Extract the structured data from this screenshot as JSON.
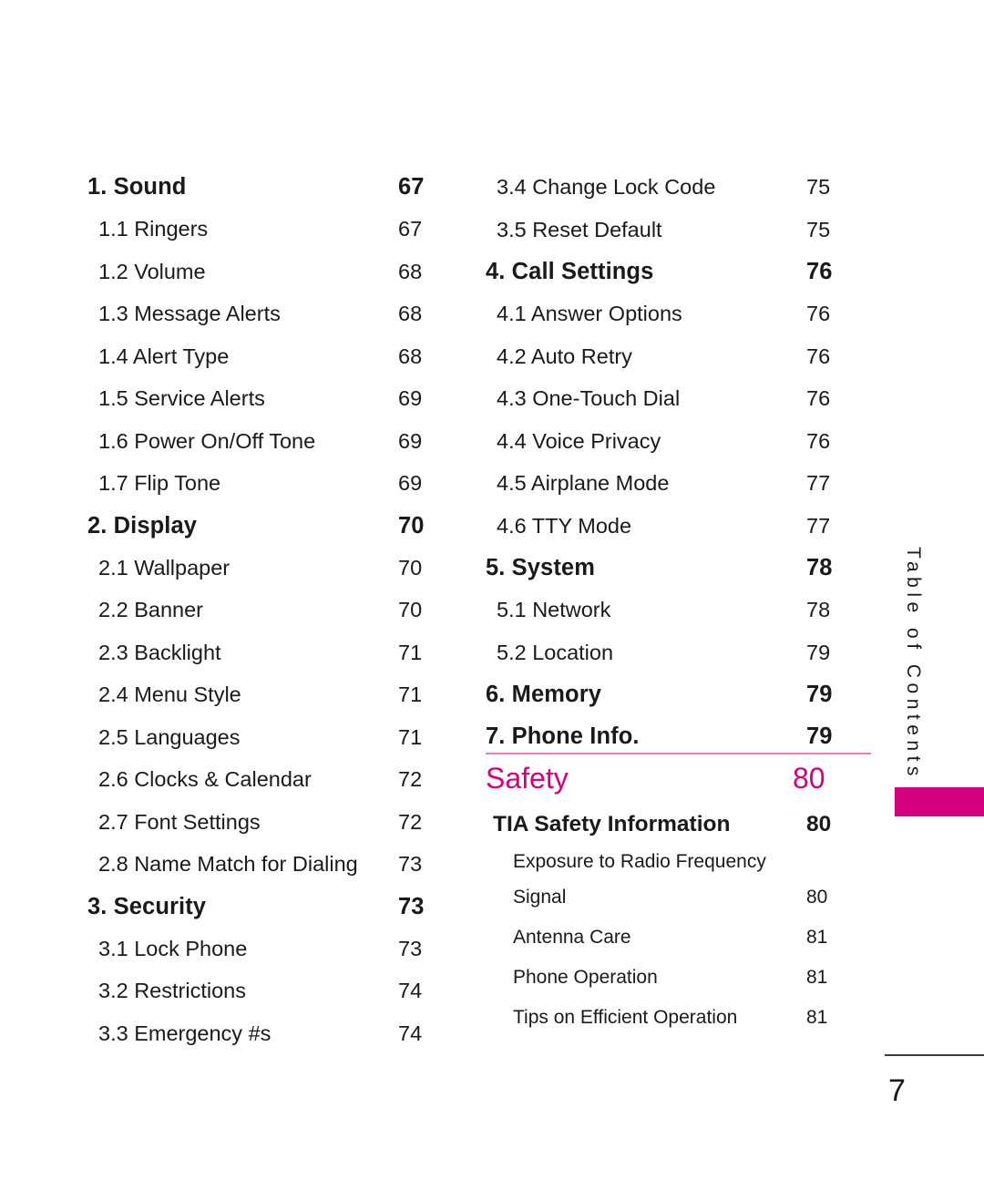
{
  "document": {
    "page_number": "7",
    "side_tab_label": "Table of Contents",
    "accent_color": "#d4007f",
    "divider_color": "#e97fbe"
  },
  "left_column": [
    {
      "level": "major",
      "label": "1. Sound",
      "page": "67"
    },
    {
      "level": "sub",
      "label": "1.1 Ringers",
      "page": "67"
    },
    {
      "level": "sub",
      "label": "1.2 Volume",
      "page": "68"
    },
    {
      "level": "sub",
      "label": "1.3 Message Alerts",
      "page": "68"
    },
    {
      "level": "sub",
      "label": "1.4 Alert Type",
      "page": "68"
    },
    {
      "level": "sub",
      "label": "1.5 Service Alerts",
      "page": "69"
    },
    {
      "level": "sub",
      "label": "1.6 Power On/Off Tone",
      "page": "69"
    },
    {
      "level": "sub",
      "label": "1.7 Flip Tone",
      "page": "69"
    },
    {
      "level": "major",
      "label": "2. Display",
      "page": "70"
    },
    {
      "level": "sub",
      "label": "2.1 Wallpaper",
      "page": "70"
    },
    {
      "level": "sub",
      "label": "2.2 Banner",
      "page": "70"
    },
    {
      "level": "sub",
      "label": "2.3 Backlight",
      "page": "71"
    },
    {
      "level": "sub",
      "label": "2.4 Menu Style",
      "page": "71"
    },
    {
      "level": "sub",
      "label": "2.5 Languages",
      "page": "71"
    },
    {
      "level": "sub",
      "label": "2.6 Clocks & Calendar",
      "page": "72"
    },
    {
      "level": "sub",
      "label": "2.7 Font Settings",
      "page": "72"
    },
    {
      "level": "sub",
      "label": "2.8  Name Match for Dialing",
      "page": "73"
    },
    {
      "level": "major",
      "label": "3. Security",
      "page": "73"
    },
    {
      "level": "sub",
      "label": "3.1 Lock Phone",
      "page": "73"
    },
    {
      "level": "sub",
      "label": "3.2 Restrictions",
      "page": "74"
    },
    {
      "level": "sub",
      "label": "3.3 Emergency #s",
      "page": "74"
    }
  ],
  "right_column": [
    {
      "level": "sub",
      "label": "3.4 Change Lock Code",
      "page": "75"
    },
    {
      "level": "sub",
      "label": "3.5 Reset Default",
      "page": "75"
    },
    {
      "level": "major",
      "label": "4. Call Settings",
      "page": "76"
    },
    {
      "level": "sub",
      "label": "4.1 Answer Options",
      "page": "76"
    },
    {
      "level": "sub",
      "label": "4.2 Auto Retry",
      "page": "76"
    },
    {
      "level": "sub",
      "label": "4.3 One-Touch Dial",
      "page": "76"
    },
    {
      "level": "sub",
      "label": "4.4 Voice Privacy",
      "page": "76"
    },
    {
      "level": "sub",
      "label": "4.5 Airplane Mode",
      "page": "77"
    },
    {
      "level": "sub",
      "label": "4.6 TTY Mode",
      "page": "77"
    },
    {
      "level": "major",
      "label": "5. System",
      "page": "78"
    },
    {
      "level": "sub",
      "label": "5.1 Network",
      "page": "78"
    },
    {
      "level": "sub",
      "label": "5.2 Location",
      "page": "79"
    },
    {
      "level": "major",
      "label": "6. Memory",
      "page": "79"
    },
    {
      "level": "major",
      "label": "7. Phone Info.",
      "page": "79"
    }
  ],
  "safety": {
    "heading": "Safety",
    "heading_page": "80",
    "section": "TIA Safety Information",
    "section_page": "80",
    "items": [
      {
        "line1": "Exposure to Radio Frequency",
        "line2": "Signal",
        "page": "80"
      },
      {
        "line1": "Antenna Care",
        "page": "81"
      },
      {
        "line1": "Phone Operation",
        "page": "81"
      },
      {
        "line1": "Tips on Efficient Operation",
        "page": "81"
      }
    ]
  }
}
